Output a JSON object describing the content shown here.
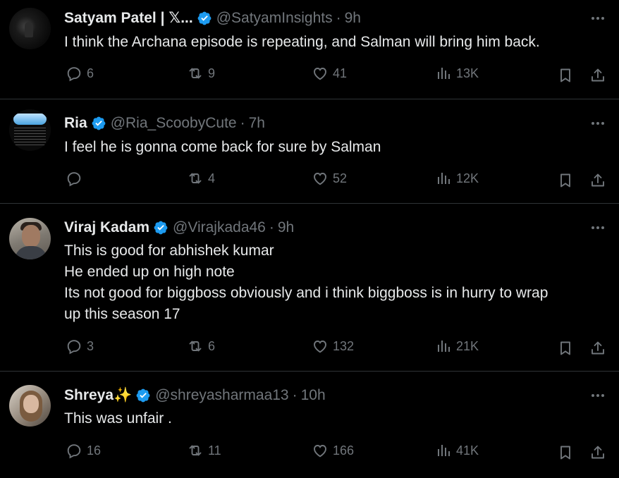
{
  "tweets": [
    {
      "name": "Satyam Patel | 𝕏...",
      "handle": "@SatyamInsights",
      "time": "9h",
      "text": [
        "I think the Archana episode is repeating, and  Salman will bring him back."
      ],
      "replies": "6",
      "reposts": "9",
      "likes": "41",
      "views": "13K"
    },
    {
      "name": "Ria",
      "handle": "@Ria_ScoobyCute",
      "time": "7h",
      "text": [
        "I feel he is gonna come back for sure by Salman"
      ],
      "replies": "",
      "reposts": "4",
      "likes": "52",
      "views": "12K"
    },
    {
      "name": "Viraj Kadam",
      "handle": "@Virajkada46",
      "time": "9h",
      "text": [
        "This is good for abhishek kumar",
        "He ended up on high note",
        "Its not good for biggboss obviously and i think biggboss is in hurry to wrap",
        "up this season 17"
      ],
      "replies": "3",
      "reposts": "6",
      "likes": "132",
      "views": "21K"
    },
    {
      "name": "Shreya✨",
      "handle": "@shreyasharmaa13",
      "time": "10h",
      "text": [
        "This was unfair ."
      ],
      "replies": "16",
      "reposts": "11",
      "likes": "166",
      "views": "41K"
    }
  ],
  "separator": "·",
  "colors": {
    "background": "#000000",
    "text": "#e7e9ea",
    "muted": "#71767b",
    "verified": "#1d9bf0",
    "divider": "#2f3336"
  },
  "icons": [
    "verified-badge-icon",
    "more-icon",
    "reply-icon",
    "repost-icon",
    "like-icon",
    "views-icon",
    "bookmark-icon",
    "share-icon"
  ]
}
